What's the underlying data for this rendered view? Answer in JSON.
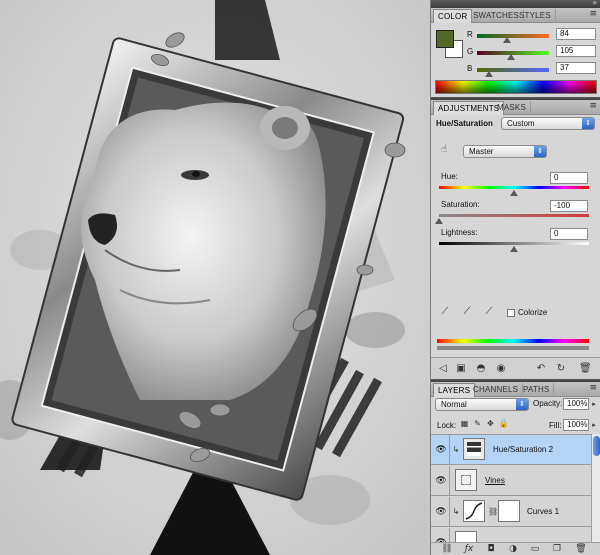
{
  "color_panel": {
    "tabs": [
      "COLOR",
      "SWATCHES",
      "STYLES"
    ],
    "channels": [
      {
        "label": "R",
        "value": "84"
      },
      {
        "label": "G",
        "value": "105"
      },
      {
        "label": "B",
        "value": "37"
      }
    ],
    "foreground": "#546925",
    "background": "#ffffff"
  },
  "adjustments_panel": {
    "tabs": [
      "ADJUSTMENTS",
      "MASKS"
    ],
    "title": "Hue/Saturation",
    "preset": "Custom",
    "channel": "Master",
    "hue_label": "Hue:",
    "hue_value": "0",
    "saturation_label": "Saturation:",
    "saturation_value": "-100",
    "lightness_label": "Lightness:",
    "lightness_value": "0",
    "colorize_label": "Colorize"
  },
  "layers_panel": {
    "tabs": [
      "LAYERS",
      "CHANNELS",
      "PATHS"
    ],
    "blend_mode": "Normal",
    "opacity_label": "Opacity:",
    "opacity_value": "100%",
    "lock_label": "Lock:",
    "fill_label": "Fill:",
    "fill_value": "100%",
    "layers": [
      {
        "name": "Hue/Saturation 2"
      },
      {
        "name": "Vines"
      },
      {
        "name": "Curves 1"
      }
    ],
    "footer_icons": [
      "link-icon",
      "fx-icon",
      "mask-icon",
      "adjustment-icon",
      "folder-icon",
      "new-layer-icon",
      "trash-icon"
    ]
  }
}
